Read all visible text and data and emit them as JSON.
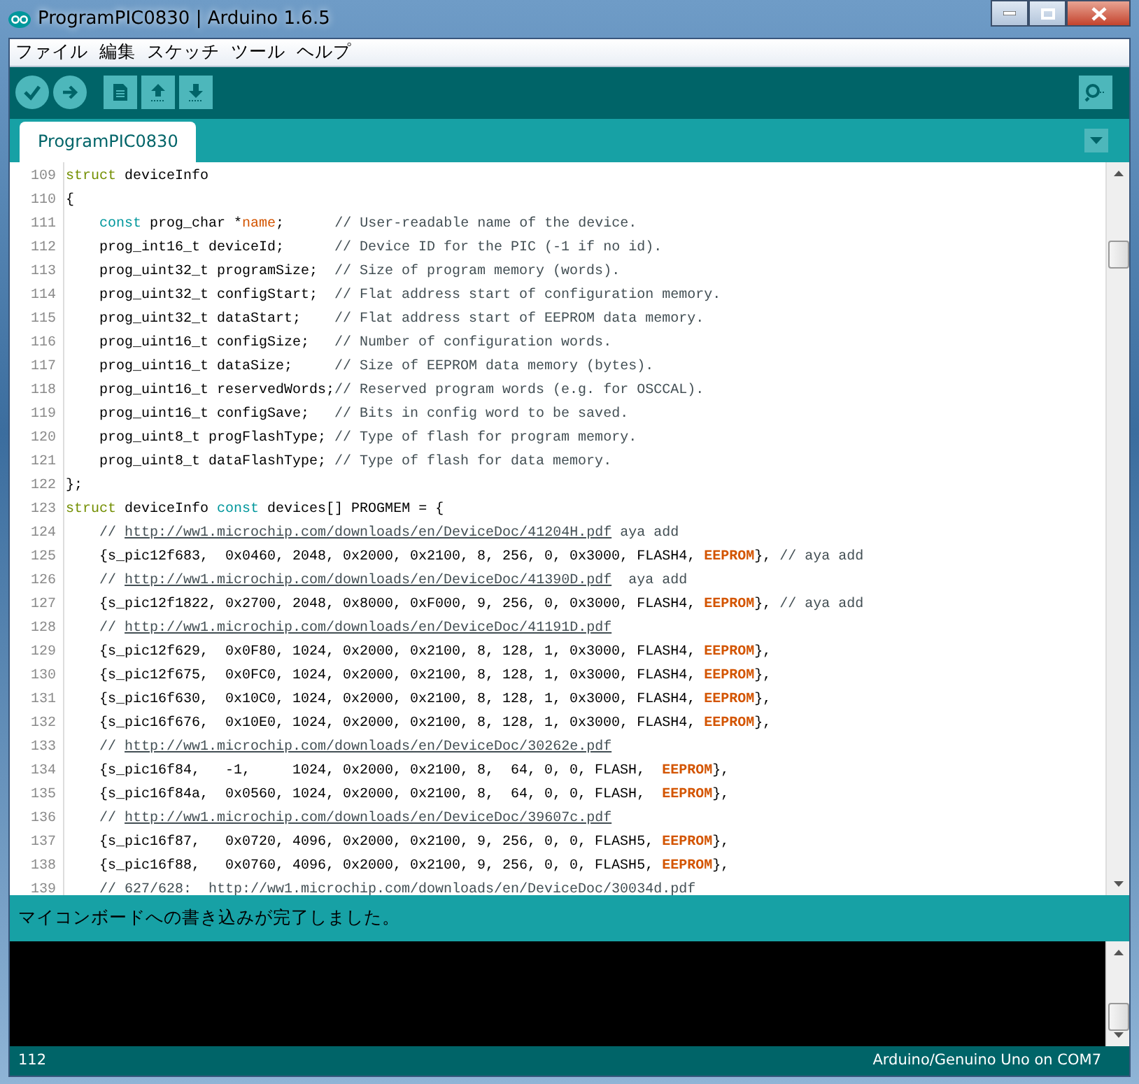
{
  "window": {
    "title": "ProgramPIC0830 | Arduino 1.6.5"
  },
  "menu": [
    "ファイル",
    "編集",
    "スケッチ",
    "ツール",
    "ヘルプ"
  ],
  "tabs": [
    {
      "label": "ProgramPIC0830",
      "selected": true
    }
  ],
  "editor": {
    "lines": [
      {
        "number": "109",
        "indented": false,
        "segments": [
          {
            "kind": "keyword",
            "text": "struct"
          },
          {
            "kind": "plain",
            "text": " deviceInfo"
          }
        ]
      },
      {
        "number": "110",
        "indented": false,
        "segments": [
          {
            "kind": "plain",
            "text": "{"
          }
        ]
      },
      {
        "number": "111",
        "indented": true,
        "segments": [
          {
            "kind": "type",
            "text": "const"
          },
          {
            "kind": "plain",
            "text": " prog_char *"
          },
          {
            "kind": "name",
            "text": "name"
          },
          {
            "kind": "plain",
            "text": ";      "
          },
          {
            "kind": "comment",
            "text": "// User-readable name of the device."
          }
        ]
      },
      {
        "number": "112",
        "indented": true,
        "segments": [
          {
            "kind": "plain",
            "text": "prog_int16_t deviceId;      "
          },
          {
            "kind": "comment",
            "text": "// Device ID for the PIC (-1 if no id)."
          }
        ]
      },
      {
        "number": "113",
        "indented": true,
        "segments": [
          {
            "kind": "plain",
            "text": "prog_uint32_t programSize;  "
          },
          {
            "kind": "comment",
            "text": "// Size of program memory (words)."
          }
        ]
      },
      {
        "number": "114",
        "indented": true,
        "segments": [
          {
            "kind": "plain",
            "text": "prog_uint32_t configStart;  "
          },
          {
            "kind": "comment",
            "text": "// Flat address start of configuration memory."
          }
        ]
      },
      {
        "number": "115",
        "indented": true,
        "segments": [
          {
            "kind": "plain",
            "text": "prog_uint32_t dataStart;    "
          },
          {
            "kind": "comment",
            "text": "// Flat address start of EEPROM data memory."
          }
        ]
      },
      {
        "number": "116",
        "indented": true,
        "segments": [
          {
            "kind": "plain",
            "text": "prog_uint16_t configSize;   "
          },
          {
            "kind": "comment",
            "text": "// Number of configuration words."
          }
        ]
      },
      {
        "number": "117",
        "indented": true,
        "segments": [
          {
            "kind": "plain",
            "text": "prog_uint16_t dataSize;     "
          },
          {
            "kind": "comment",
            "text": "// Size of EEPROM data memory (bytes)."
          }
        ]
      },
      {
        "number": "118",
        "indented": true,
        "segments": [
          {
            "kind": "plain",
            "text": "prog_uint16_t reservedWords;"
          },
          {
            "kind": "comment",
            "text": "// Reserved program words (e.g. for OSCCAL)."
          }
        ]
      },
      {
        "number": "119",
        "indented": true,
        "segments": [
          {
            "kind": "plain",
            "text": "prog_uint16_t configSave;   "
          },
          {
            "kind": "comment",
            "text": "// Bits in config word to be saved."
          }
        ]
      },
      {
        "number": "120",
        "indented": true,
        "segments": [
          {
            "kind": "plain",
            "text": "prog_uint8_t progFlashType; "
          },
          {
            "kind": "comment",
            "text": "// Type of flash for program memory."
          }
        ]
      },
      {
        "number": "121",
        "indented": true,
        "segments": [
          {
            "kind": "plain",
            "text": "prog_uint8_t dataFlashType; "
          },
          {
            "kind": "comment",
            "text": "// Type of flash for data memory."
          }
        ]
      },
      {
        "number": "122",
        "indented": false,
        "segments": [
          {
            "kind": "plain",
            "text": "};"
          }
        ]
      },
      {
        "number": "123",
        "indented": false,
        "segments": [
          {
            "kind": "keyword",
            "text": "struct"
          },
          {
            "kind": "plain",
            "text": " deviceInfo "
          },
          {
            "kind": "type",
            "text": "const"
          },
          {
            "kind": "plain",
            "text": " devices[] PROGMEM = {"
          }
        ]
      },
      {
        "number": "124",
        "indented": true,
        "segments": [
          {
            "kind": "comment",
            "text": "// "
          },
          {
            "kind": "link",
            "text": "http://ww1.microchip.com/downloads/en/DeviceDoc/41204H.pdf"
          },
          {
            "kind": "comment",
            "text": " aya add"
          }
        ]
      },
      {
        "number": "125",
        "indented": true,
        "segments": [
          {
            "kind": "plain",
            "text": "{s_pic12f683,  0x0460, 2048, 0x2000, 0x2100, 8, 256, 0, 0x3000, FLASH4, "
          },
          {
            "kind": "constant",
            "text": "EEPROM"
          },
          {
            "kind": "plain",
            "text": "}, "
          },
          {
            "kind": "comment",
            "text": "// aya add"
          }
        ]
      },
      {
        "number": "126",
        "indented": true,
        "segments": [
          {
            "kind": "comment",
            "text": "// "
          },
          {
            "kind": "link",
            "text": "http://ww1.microchip.com/downloads/en/DeviceDoc/41390D.pdf"
          },
          {
            "kind": "comment",
            "text": "  aya add"
          }
        ]
      },
      {
        "number": "127",
        "indented": true,
        "segments": [
          {
            "kind": "plain",
            "text": "{s_pic12f1822, 0x2700, 2048, 0x8000, 0xF000, 9, 256, 0, 0x3000, FLASH4, "
          },
          {
            "kind": "constant",
            "text": "EEPROM"
          },
          {
            "kind": "plain",
            "text": "}, "
          },
          {
            "kind": "comment",
            "text": "// aya add"
          }
        ]
      },
      {
        "number": "128",
        "indented": true,
        "segments": [
          {
            "kind": "comment",
            "text": "// "
          },
          {
            "kind": "link",
            "text": "http://ww1.microchip.com/downloads/en/DeviceDoc/41191D.pdf"
          }
        ]
      },
      {
        "number": "129",
        "indented": true,
        "segments": [
          {
            "kind": "plain",
            "text": "{s_pic12f629,  0x0F80, 1024, 0x2000, 0x2100, 8, 128, 1, 0x3000, FLASH4, "
          },
          {
            "kind": "constant",
            "text": "EEPROM"
          },
          {
            "kind": "plain",
            "text": "},"
          }
        ]
      },
      {
        "number": "130",
        "indented": true,
        "segments": [
          {
            "kind": "plain",
            "text": "{s_pic12f675,  0x0FC0, 1024, 0x2000, 0x2100, 8, 128, 1, 0x3000, FLASH4, "
          },
          {
            "kind": "constant",
            "text": "EEPROM"
          },
          {
            "kind": "plain",
            "text": "},"
          }
        ]
      },
      {
        "number": "131",
        "indented": true,
        "segments": [
          {
            "kind": "plain",
            "text": "{s_pic16f630,  0x10C0, 1024, 0x2000, 0x2100, 8, 128, 1, 0x3000, FLASH4, "
          },
          {
            "kind": "constant",
            "text": "EEPROM"
          },
          {
            "kind": "plain",
            "text": "},"
          }
        ]
      },
      {
        "number": "132",
        "indented": true,
        "segments": [
          {
            "kind": "plain",
            "text": "{s_pic16f676,  0x10E0, 1024, 0x2000, 0x2100, 8, 128, 1, 0x3000, FLASH4, "
          },
          {
            "kind": "constant",
            "text": "EEPROM"
          },
          {
            "kind": "plain",
            "text": "},"
          }
        ]
      },
      {
        "number": "133",
        "indented": true,
        "segments": [
          {
            "kind": "comment",
            "text": "// "
          },
          {
            "kind": "link",
            "text": "http://ww1.microchip.com/downloads/en/DeviceDoc/30262e.pdf"
          }
        ]
      },
      {
        "number": "134",
        "indented": true,
        "segments": [
          {
            "kind": "plain",
            "text": "{s_pic16f84,   -1,     1024, 0x2000, 0x2100, 8,  64, 0, 0, FLASH,  "
          },
          {
            "kind": "constant",
            "text": "EEPROM"
          },
          {
            "kind": "plain",
            "text": "},"
          }
        ]
      },
      {
        "number": "135",
        "indented": true,
        "segments": [
          {
            "kind": "plain",
            "text": "{s_pic16f84a,  0x0560, 1024, 0x2000, 0x2100, 8,  64, 0, 0, FLASH,  "
          },
          {
            "kind": "constant",
            "text": "EEPROM"
          },
          {
            "kind": "plain",
            "text": "},"
          }
        ]
      },
      {
        "number": "136",
        "indented": true,
        "segments": [
          {
            "kind": "comment",
            "text": "// "
          },
          {
            "kind": "link",
            "text": "http://ww1.microchip.com/downloads/en/DeviceDoc/39607c.pdf"
          }
        ]
      },
      {
        "number": "137",
        "indented": true,
        "segments": [
          {
            "kind": "plain",
            "text": "{s_pic16f87,   0x0720, 4096, 0x2000, 0x2100, 9, 256, 0, 0, FLASH5, "
          },
          {
            "kind": "constant",
            "text": "EEPROM"
          },
          {
            "kind": "plain",
            "text": "},"
          }
        ]
      },
      {
        "number": "138",
        "indented": true,
        "segments": [
          {
            "kind": "plain",
            "text": "{s_pic16f88,   0x0760, 4096, 0x2000, 0x2100, 9, 256, 0, 0, FLASH5, "
          },
          {
            "kind": "constant",
            "text": "EEPROM"
          },
          {
            "kind": "plain",
            "text": "},"
          }
        ]
      },
      {
        "number": "139",
        "indented": true,
        "segments": [
          {
            "kind": "comment",
            "text": "// 627/628:  http://ww1.microchip.com/downloads/en/DeviceDoc/30034d.pdf"
          }
        ]
      }
    ]
  },
  "message": "マイコンボードへの書き込みが完了しました。",
  "status_bar": {
    "line": "112",
    "board": "Arduino/Genuino Uno on COM7"
  }
}
